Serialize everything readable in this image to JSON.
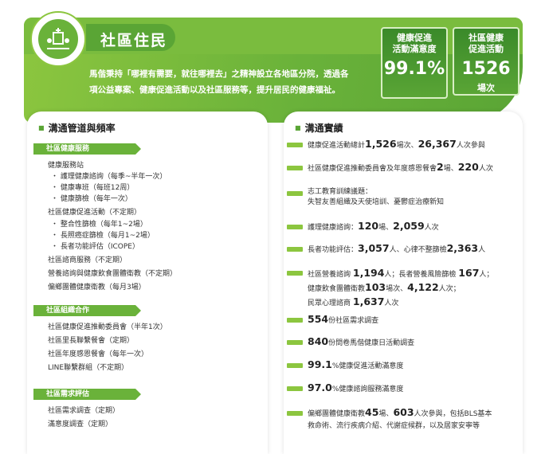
{
  "header": {
    "title": "社區住民",
    "intro_line1": "馬偕秉持「哪裡有需要，就往哪裡去」之精神設立各地區分院，透過各",
    "intro_line2": "項公益專案、健康促進活動以及社區服務等，提升居民的健康福祉。"
  },
  "stats": [
    {
      "label_line1": "健康促進",
      "label_line2": "活動滿意度",
      "value": "99.1%",
      "unit": ""
    },
    {
      "label_line1": "社區健康",
      "label_line2": "促進活動",
      "value": "1526",
      "unit": "場次"
    }
  ],
  "colors": {
    "brand_green": "#6ab23a",
    "light_green": "#8cc63f",
    "dark_green": "#3a8a2a"
  },
  "left_panel": {
    "heading": "溝通管道與頻率",
    "sections": [
      {
        "tag": "社區健康服務",
        "lines": [
          "健康服務站",
          "・ 護理健康諮詢（每季~半年一次）",
          "・ 健康專班（每班12周）",
          "・ 健康篩檢（每年一次）",
          "社區健康促進活動（不定期）",
          "・ 整合性篩檢（每年1~2場）",
          "・ 長照癌症篩檢（每月1~2場）",
          "・ 長者功能評估（ICOPE）",
          "社區諮商服務（不定期）",
          "營養諮詢與健康飲食團體衛教（不定期）",
          "偏鄉團體健康衛教（每月3場）"
        ]
      },
      {
        "tag": "社區組織合作",
        "lines": [
          "社區健康促進推動委員會（半年1次）",
          "社區里長聯繫餐會（定期）",
          "社區年度感恩餐會（每年一次）",
          "LINE聯繫群組（不定期）"
        ]
      },
      {
        "tag": "社區需求評估",
        "lines": [
          "社區需求調查（定期）",
          "滿意度調查（定期）"
        ]
      }
    ]
  },
  "right_panel": {
    "heading": "溝通實績",
    "items": [
      {
        "parts": [
          "健康促進活動總計",
          "1,526",
          "場次、",
          "26,367",
          "人次參與"
        ]
      },
      {
        "parts": [
          "社區健康促進推動委員會及年度感恩餐會",
          "2",
          "場、",
          "220",
          "人次"
        ]
      },
      {
        "parts": [
          "志工教育訓練議題："
        ],
        "line2": "失智友善組織及天使培訓、憂鬱症治療新知"
      },
      {
        "parts": [
          "護理健康諮詢：",
          "120",
          "場、",
          "2,059",
          "人次"
        ]
      },
      {
        "parts": [
          "長者功能評估：",
          "3,057",
          "人、心律不整篩檢",
          "2,363",
          "人"
        ]
      },
      {
        "parts": [
          "社區營養諮詢 ",
          "1,194",
          "人；長者營養風險篩檢 ",
          "167",
          "人；"
        ],
        "line2a": "健康飲食團體衛教",
        "line2b": "103",
        "line2c": "場次、",
        "line2d": "4,122",
        "line2e": "人次；",
        "line3a": "民眾心理諮商 ",
        "line3b": "1,637",
        "line3c": "人次"
      },
      {
        "parts": [
          "",
          "554",
          "份社區需求調查"
        ]
      },
      {
        "parts": [
          "",
          "840",
          "份問卷馬偕健康日活動調查"
        ]
      },
      {
        "parts": [
          "",
          "99.1",
          "%健康促進活動滿意度"
        ]
      },
      {
        "parts": [
          "",
          "97.0",
          "%健康諮詢服務滿意度"
        ]
      },
      {
        "parts": [
          "偏鄉團體健康衛教",
          "45",
          "場、",
          "603",
          "人次參與，包括BLS基本"
        ],
        "line2": "救命術、流行疾病介紹、代謝症候群，以及居家安寧等"
      }
    ]
  }
}
